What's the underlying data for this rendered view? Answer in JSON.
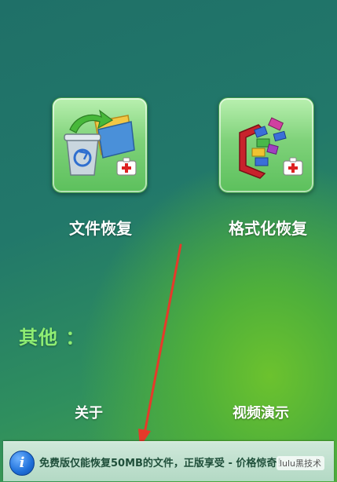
{
  "tiles": [
    {
      "label": "文件恢复",
      "icon": "recycle-bin-files-icon"
    },
    {
      "label": "格式化恢复",
      "icon": "format-recovery-blocks-icon"
    }
  ],
  "section": {
    "heading": "其他 ："
  },
  "links": [
    {
      "label": "关于"
    },
    {
      "label": "视频演示"
    }
  ],
  "banner": {
    "icon": "info-icon",
    "icon_glyph": "i",
    "text": "免费版仅能恢复50MB的文件，正版享受 - 价格惊奇！",
    "watermark": "lulu黑技术"
  },
  "annotation": {
    "arrow_color": "#e53a2a"
  },
  "colors": {
    "heading": "#8fee73",
    "tile_top": "#b9f0b0",
    "tile_bottom": "#5cc05c"
  }
}
